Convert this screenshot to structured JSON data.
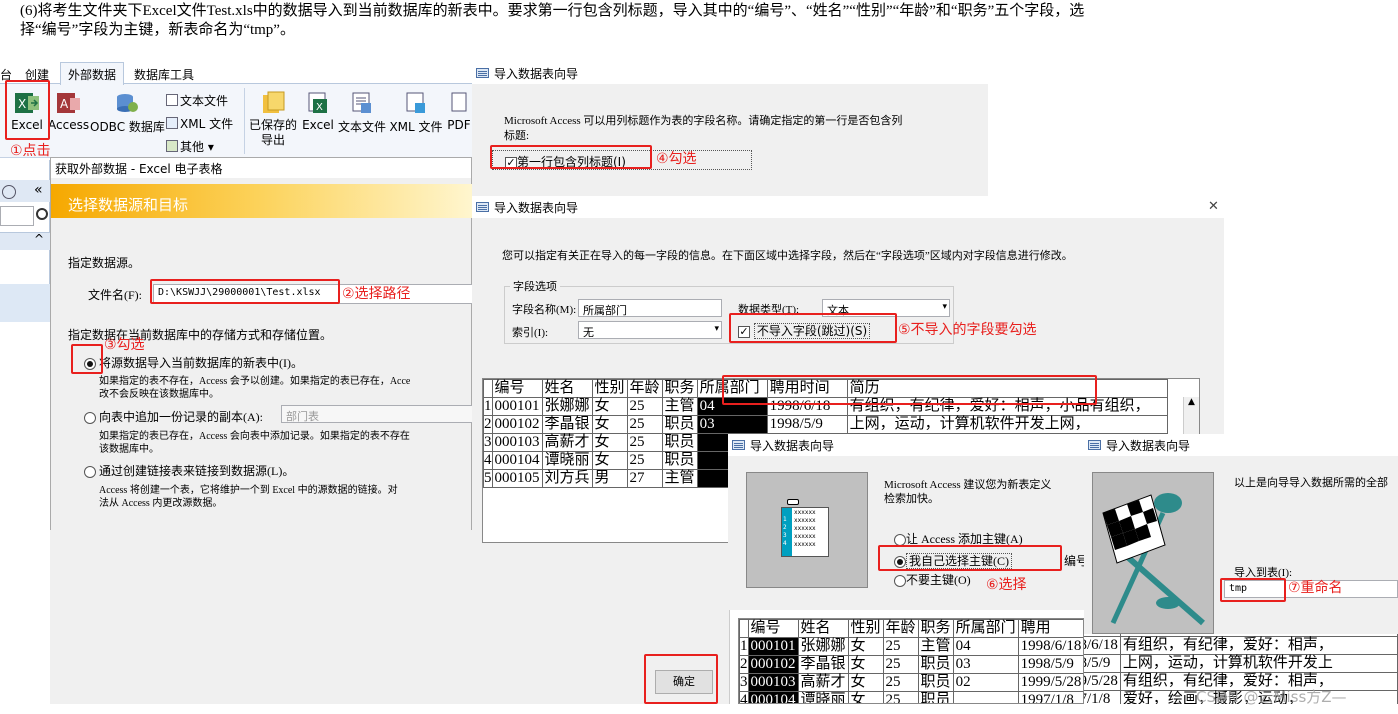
{
  "question": {
    "line1": "(6)将考生文件夹下Excel文件Test.xls中的数据导入到当前数据库的新表中。要求第一行包含列标题，导入其中的“编号”、“姓名”“性别”“年龄”和“职务”五个字段，选",
    "line2": "择“编号”字段为主键，新表命名为“tmp”。"
  },
  "ribbon": {
    "tabs": [
      "台",
      "创建",
      "外部数据",
      "数据库工具"
    ],
    "import_buttons": [
      "Excel",
      "Access",
      "ODBC 数据库"
    ],
    "small_items": [
      "文本文件",
      "XML 文件",
      "其他 ▾"
    ],
    "export_buttons": [
      "已保存的\n导出",
      "Excel",
      "文本文件",
      "XML 文件",
      "PDF"
    ]
  },
  "nav": {
    "chevron": "«",
    "expand": "^"
  },
  "get_external": {
    "title": "获取外部数据 - Excel 电子表格",
    "header": "选择数据源和目标",
    "source_label": "指定数据源。",
    "file_label": "文件名(F):",
    "file_value": "D:\\KSWJJ\\29000001\\Test.xlsx",
    "store_label": "指定数据在当前数据库中的存储方式和存储位置。",
    "opt1": "将源数据导入当前数据库的新表中(I)。",
    "opt1_desc1": "如果指定的表不存在，Access 会予以创建。如果指定的表已存在，Acce",
    "opt1_desc2": "改不会反映在该数据库中。",
    "opt2": "向表中追加一份记录的副本(A):",
    "opt2_select": "部门表",
    "opt2_desc1": "如果指定的表已存在，Access 会向表中添加记录。如果指定的表不存在",
    "opt2_desc2": "该数据库中。",
    "opt3": "通过创建链接表来链接到数据源(L)。",
    "opt3_desc1": "Access 将创建一个表，它将维护一个到 Excel 中的源数据的链接。对",
    "opt3_desc2": "法从 Access 内更改源数据。",
    "ok": "确定"
  },
  "wizard1": {
    "title": "导入数据表向导",
    "text1": "Microsoft Access 可以用列标题作为表的字段名称。请确定指定的第一行是否包含列",
    "text2": "标题:",
    "checkbox": "第一行包含列标题(I)",
    "check": "✓"
  },
  "wizard2": {
    "title": "导入数据表向导",
    "close": "✕",
    "intro": "您可以指定有关正在导入的每一字段的信息。在下面区域中选择字段，然后在“字段选项”区域内对字段信息进行修改。",
    "group": "字段选项",
    "name_label": "字段名称(M):",
    "name_value": "所属部门",
    "type_label": "数据类型(T):",
    "type_value": "文本",
    "index_label": "索引(I):",
    "index_value": "无",
    "skip": "不导入字段(跳过)(S)",
    "check": "✓",
    "headers": [
      "编号",
      "姓名",
      "性别",
      "年龄",
      "职务",
      "所属部门",
      "聘用时间",
      "简历"
    ],
    "rows": [
      [
        "1",
        "000101",
        "张娜娜",
        "女",
        "25",
        "主管",
        "04",
        "1998/6/18",
        "有组织，有纪律，爱好：相声，小品有组织，"
      ],
      [
        "2",
        "000102",
        "李晶银",
        "女",
        "25",
        "职员",
        "03",
        "1998/5/9",
        "上网，运动，计算机软件开发上网，"
      ],
      [
        "3",
        "000103",
        "高薪才",
        "女",
        "25",
        "职员",
        "",
        "",
        ""
      ],
      [
        "4",
        "000104",
        "谭晓丽",
        "女",
        "25",
        "职员",
        "",
        "",
        ""
      ],
      [
        "5",
        "000105",
        "刘方兵",
        "男",
        "27",
        "主管",
        "",
        "",
        ""
      ]
    ]
  },
  "wizard3": {
    "title": "导入数据表向导",
    "text1": "Microsoft Access 建议您为新表定义",
    "text2": "检索加快。",
    "opt1": "让 Access 添加主键(A)",
    "opt2": "我自己选择主键(C)",
    "opt2_trail": "编号",
    "opt3": "不要主键(O)",
    "thumb_lines": [
      "xxxxxx",
      "xxxxxx",
      "xxxxxx",
      "xxxxxx",
      "xxxxxx"
    ],
    "thumb_nums": [
      "1",
      "2",
      "3",
      "4"
    ],
    "headers": [
      "编号",
      "姓名",
      "性别",
      "年龄",
      "职务",
      "所属部门",
      "聘用"
    ],
    "rows": [
      [
        "1",
        "000101",
        "张娜娜",
        "女",
        "25",
        "主管",
        "04",
        "1998/6/18",
        "有组织，有纪律，爱好：相声，"
      ],
      [
        "2",
        "000102",
        "李晶银",
        "女",
        "25",
        "职员",
        "03",
        "1998/5/9",
        "上网，运动，计算机软件开发上"
      ],
      [
        "3",
        "000103",
        "高薪才",
        "女",
        "25",
        "职员",
        "02",
        "1999/5/28",
        "有组织，有纪律，爱好：相声，"
      ],
      [
        "4",
        "000104",
        "谭晓丽",
        "女",
        "25",
        "职员",
        "",
        "1997/1/8",
        "爱好，绘画，摄影，运动，"
      ]
    ]
  },
  "wizard4": {
    "title": "导入数据表向导",
    "text": "以上是向导导入数据所需的全部",
    "import_label": "导入到表(I):",
    "import_value": "tmp"
  },
  "annotations": {
    "a1": "①点击",
    "a2": "②选择路径",
    "a3": "③勾选",
    "a4": "④勾选",
    "a5": "⑤不导入的字段要勾选",
    "a6": "⑥选择",
    "a7": "⑦重命名"
  },
  "watermark": "CSDN @云Miss方Z—",
  "colors": {
    "annotation": "#e8201e",
    "wizard_header": "#f7b500",
    "selected": "#000000"
  }
}
